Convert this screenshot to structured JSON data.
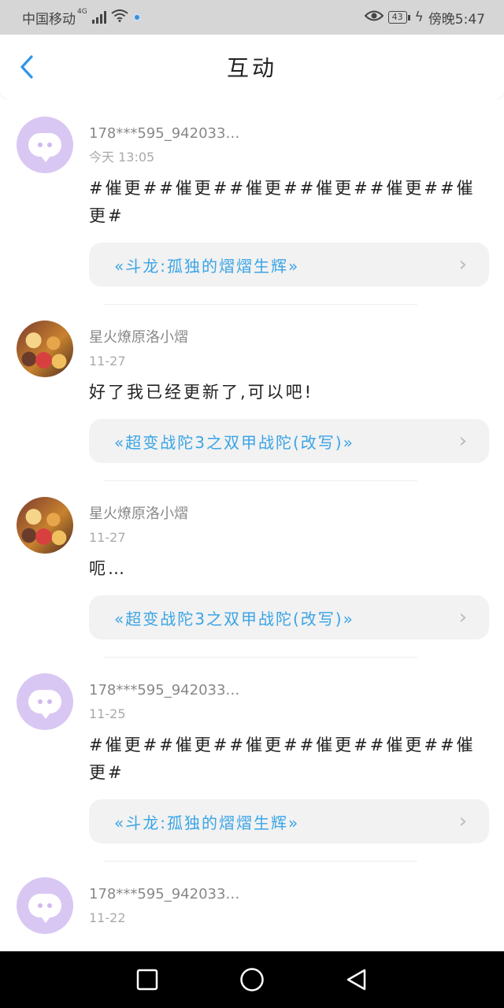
{
  "status_bar": {
    "carrier": "中国移动",
    "network": "4G",
    "battery": "43",
    "time": "傍晚5:47"
  },
  "header": {
    "title": "互动"
  },
  "items": [
    {
      "avatar": "bubble",
      "user": "178***595_942033…",
      "time": "今天 13:05",
      "message": "#催更##催更##催更##催更##催更##催更#",
      "book": "«斗龙:孤独的熠熠生辉»"
    },
    {
      "avatar": "photo",
      "user": "星火燎原洛小熠",
      "time": "11-27",
      "message": "好了我已经更新了,可以吧!",
      "book": "«超变战陀3之双甲战陀(改写)»"
    },
    {
      "avatar": "photo",
      "user": "星火燎原洛小熠",
      "time": "11-27",
      "message": "呃…",
      "book": "«超变战陀3之双甲战陀(改写)»"
    },
    {
      "avatar": "bubble",
      "user": "178***595_942033…",
      "time": "11-25",
      "message": "#催更##催更##催更##催更##催更##催更#",
      "book": "«斗龙:孤独的熠熠生辉»"
    },
    {
      "avatar": "bubble",
      "user": "178***595_942033…",
      "time": "11-22",
      "message": "",
      "book": ""
    }
  ],
  "colors": {
    "accent": "#39a4e6",
    "avatar_bubble": "#d9c7f3",
    "status_bar": "#d6d6d6"
  }
}
